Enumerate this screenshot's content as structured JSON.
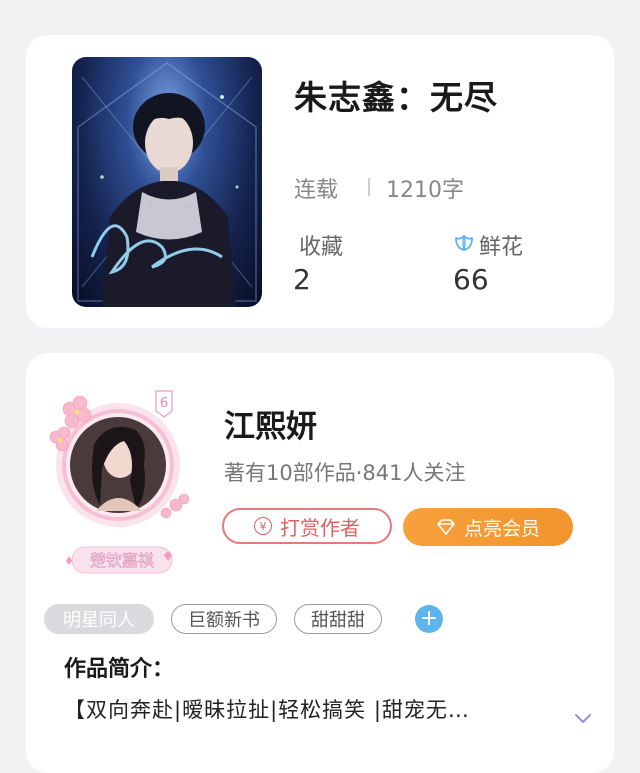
{
  "book": {
    "title": "朱志鑫：无尽",
    "status": "连载",
    "word_count": "1210字",
    "favorites_label": "收藏",
    "favorites_value": "2",
    "flowers_label": "鲜花",
    "flowers_value": "66"
  },
  "author": {
    "name": "江熙妍",
    "meta": "著有10部作品·841人关注",
    "level": "6",
    "badge": "楚钦嘉祺",
    "tip_button": "打赏作者",
    "vip_button": "点亮会员"
  },
  "tags": [
    "明星同人",
    "巨额新书",
    "甜甜甜"
  ],
  "intro": {
    "label": "作品简介：",
    "text": "【双向奔赴|暧昧拉扯|轻松搞笑 |甜宠无…"
  },
  "colors": {
    "accent_red": "#e06064",
    "vip_orange": "#f5993a",
    "add_blue": "#5fb4ee"
  }
}
